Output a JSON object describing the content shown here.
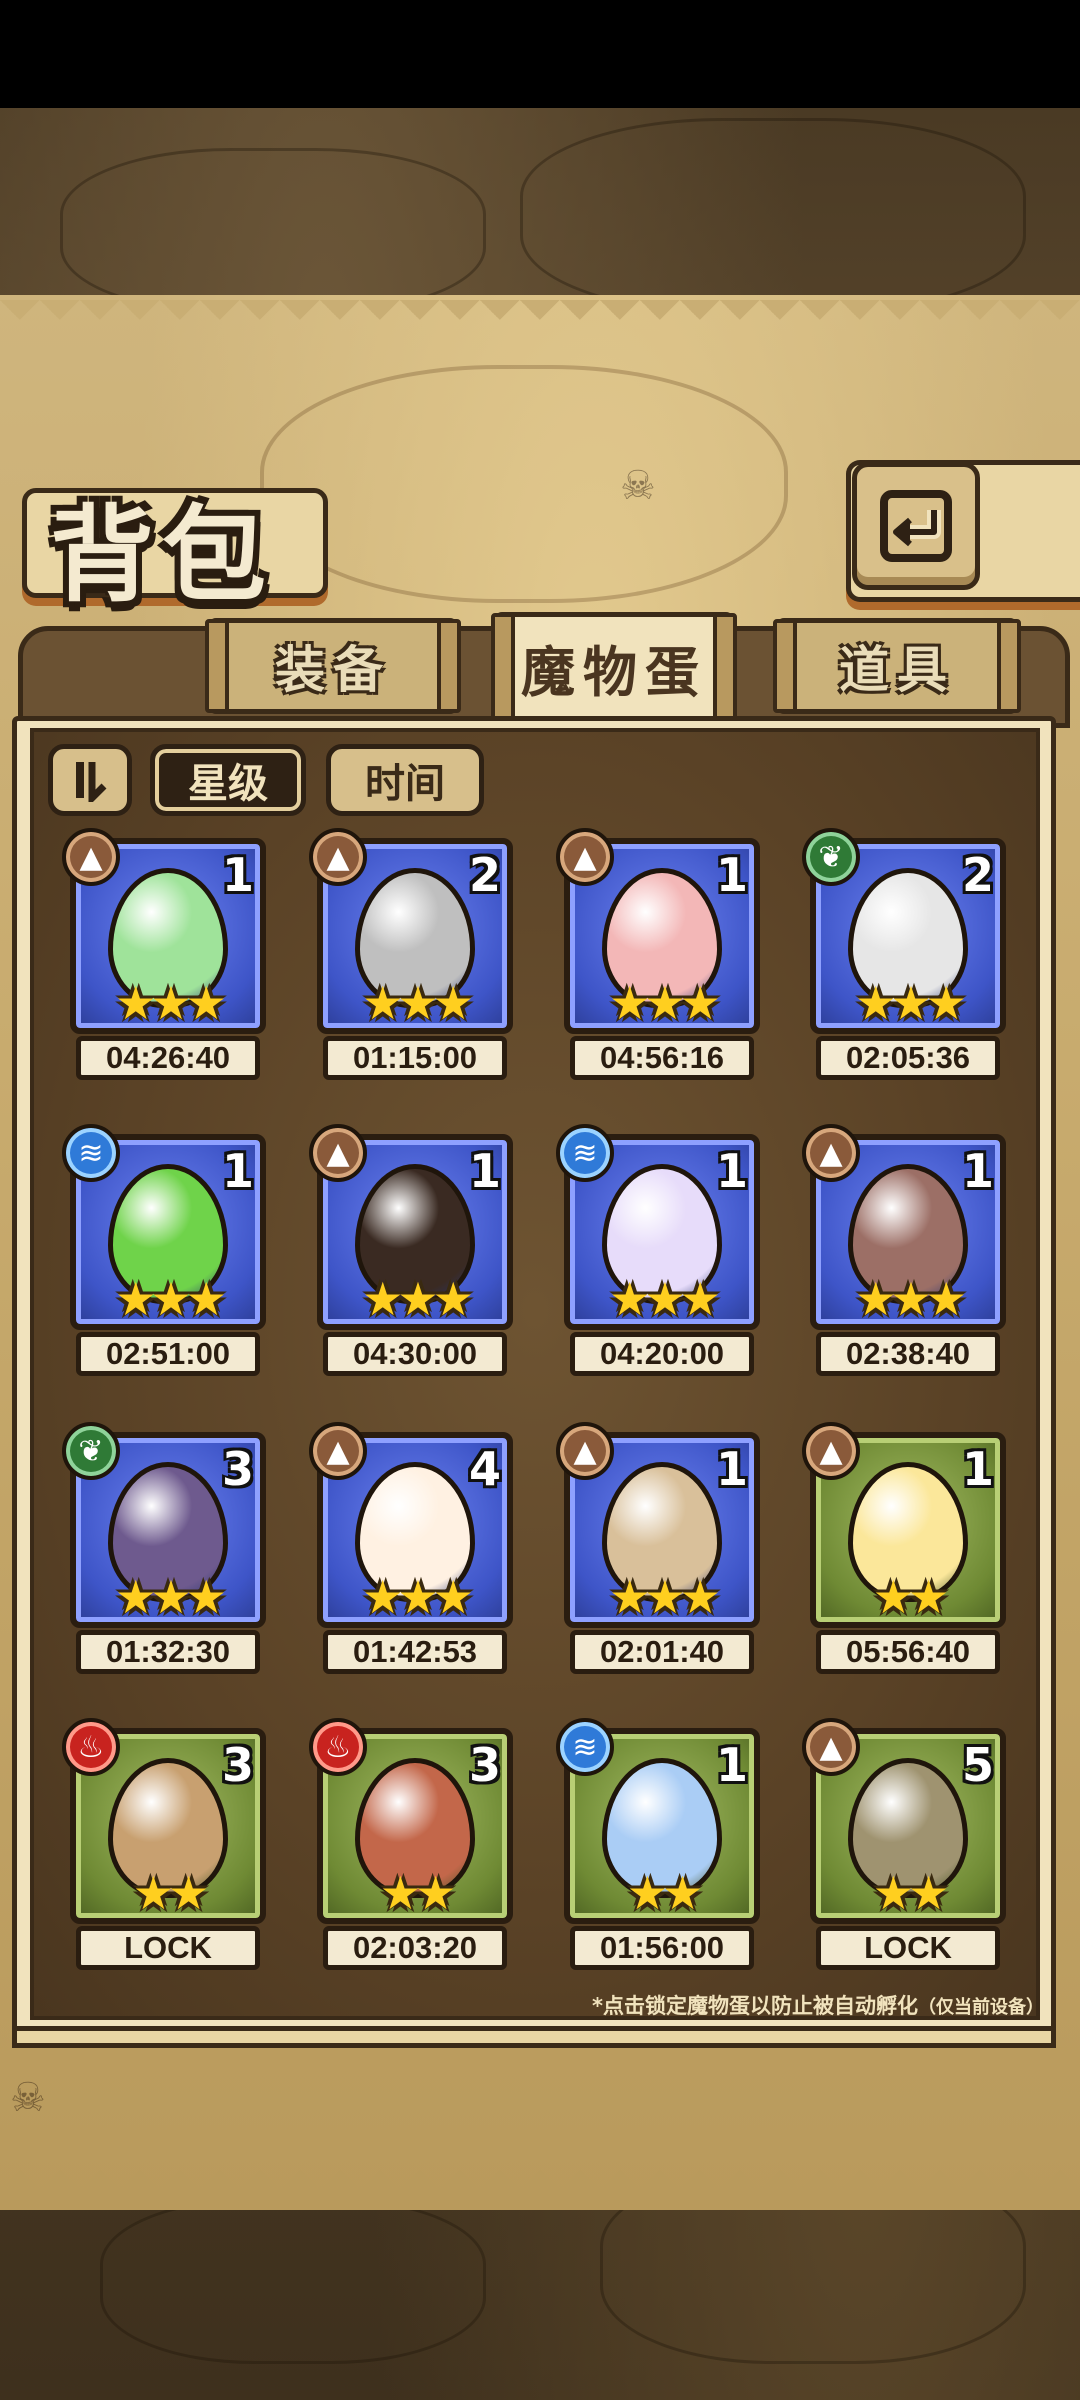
{
  "header": {
    "title": "背包"
  },
  "tabs": [
    {
      "label": "装备",
      "active": false
    },
    {
      "label": "魔物蛋",
      "active": true
    },
    {
      "label": "道具",
      "active": false
    }
  ],
  "sort": {
    "toggle_icon": "sort-order-icon",
    "options": [
      "星级",
      "时间"
    ],
    "active": "星级"
  },
  "eggs": [
    {
      "element": "earth",
      "count": "1",
      "stars": 3,
      "frame": "blue",
      "timer": "04:26:40",
      "color": "#9fe39a"
    },
    {
      "element": "earth",
      "count": "2",
      "stars": 3,
      "frame": "blue",
      "timer": "01:15:00",
      "color": "#bfbfbf"
    },
    {
      "element": "earth",
      "count": "1",
      "stars": 3,
      "frame": "blue",
      "timer": "04:56:16",
      "color": "#f3b7b7"
    },
    {
      "element": "plant",
      "count": "2",
      "stars": 3,
      "frame": "blue",
      "timer": "02:05:36",
      "color": "#e6e6e6"
    },
    {
      "element": "water",
      "count": "1",
      "stars": 3,
      "frame": "blue",
      "timer": "02:51:00",
      "color": "#6fd34a"
    },
    {
      "element": "earth",
      "count": "1",
      "stars": 3,
      "frame": "blue",
      "timer": "04:30:00",
      "color": "#3a2a22"
    },
    {
      "element": "water",
      "count": "1",
      "stars": 3,
      "frame": "blue",
      "timer": "04:20:00",
      "color": "#e7dcfa"
    },
    {
      "element": "earth",
      "count": "1",
      "stars": 3,
      "frame": "blue",
      "timer": "02:38:40",
      "color": "#9c6f66"
    },
    {
      "element": "plant",
      "count": "3",
      "stars": 3,
      "frame": "blue",
      "timer": "01:32:30",
      "color": "#6e5a8e"
    },
    {
      "element": "earth",
      "count": "4",
      "stars": 3,
      "frame": "blue",
      "timer": "01:42:53",
      "color": "#fff1e2"
    },
    {
      "element": "earth",
      "count": "1",
      "stars": 3,
      "frame": "blue",
      "timer": "02:01:40",
      "color": "#d9c09a"
    },
    {
      "element": "earth",
      "count": "1",
      "stars": 2,
      "frame": "green",
      "timer": "05:56:40",
      "color": "#fbe79a"
    },
    {
      "element": "fire",
      "count": "3",
      "stars": 2,
      "frame": "green",
      "timer": "LOCK",
      "color": "#c8a070"
    },
    {
      "element": "fire",
      "count": "3",
      "stars": 2,
      "frame": "green",
      "timer": "02:03:20",
      "color": "#c3674a"
    },
    {
      "element": "water",
      "count": "1",
      "stars": 2,
      "frame": "green",
      "timer": "01:56:00",
      "color": "#aacdf5"
    },
    {
      "element": "earth",
      "count": "5",
      "stars": 2,
      "frame": "green",
      "timer": "LOCK",
      "color": "#9f9370"
    }
  ],
  "footer_note": "*点击锁定魔物蛋以防止被自动孵化",
  "footer_note_small": "（仅当前设备）"
}
